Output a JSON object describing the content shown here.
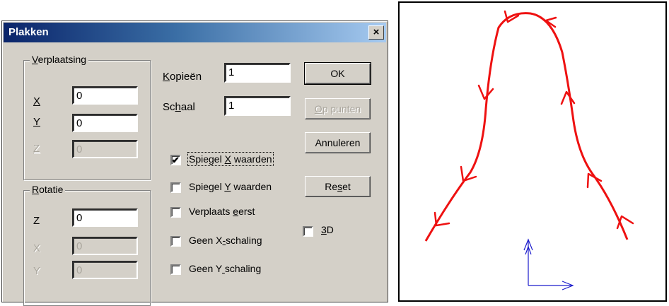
{
  "dialog": {
    "title": "Plakken",
    "close_label": "×",
    "verplaatsing": {
      "legend_u": "V",
      "legend_rest": "erplaatsing",
      "x_label": "X",
      "x_value": "0",
      "y_label": "Y",
      "y_value": "0",
      "z_label": "Z",
      "z_value": "0"
    },
    "rotatie": {
      "legend_u": "R",
      "legend_rest": "otatie",
      "z_label": "Z",
      "z_value": "0",
      "x_label": "X",
      "x_value": "0",
      "y_label": "Y",
      "y_value": "0"
    },
    "kopieen": {
      "label_u": "K",
      "label_rest": "opieën",
      "value": "1"
    },
    "schaal": {
      "label_pre": "Sc",
      "label_u": "h",
      "label_rest": "aal",
      "value": "1"
    },
    "checkboxes": {
      "spiegel_x": {
        "pre": "Spiegel ",
        "u": "X",
        "post": " waarden",
        "checked": true,
        "mark": "✔"
      },
      "spiegel_y": {
        "pre": "Spiegel ",
        "u": "Y",
        "post": " waarden",
        "checked": false
      },
      "verplaats_eerst": {
        "pre": "Verplaats ",
        "u": "e",
        "post": "erst",
        "checked": false
      },
      "geen_x_schaling": {
        "pre": "Geen X",
        "u": "-",
        "post": "schaling",
        "checked": false
      },
      "geen_y_schaling": {
        "pre": "Geen Y",
        "u": " ",
        "post": "schaling",
        "checked": false
      },
      "three_d": {
        "pre": "",
        "u": "3",
        "post": "D",
        "checked": false
      }
    },
    "buttons": {
      "ok": "OK",
      "op_punten_u": "O",
      "op_punten_rest": "p punten",
      "annuleren": "Annuleren",
      "reset_pre": "Re",
      "reset_u": "s",
      "reset_rest": "et"
    }
  },
  "diagram": {
    "curve_color": "#ee1111",
    "axes_color": "#1c1ccc"
  }
}
